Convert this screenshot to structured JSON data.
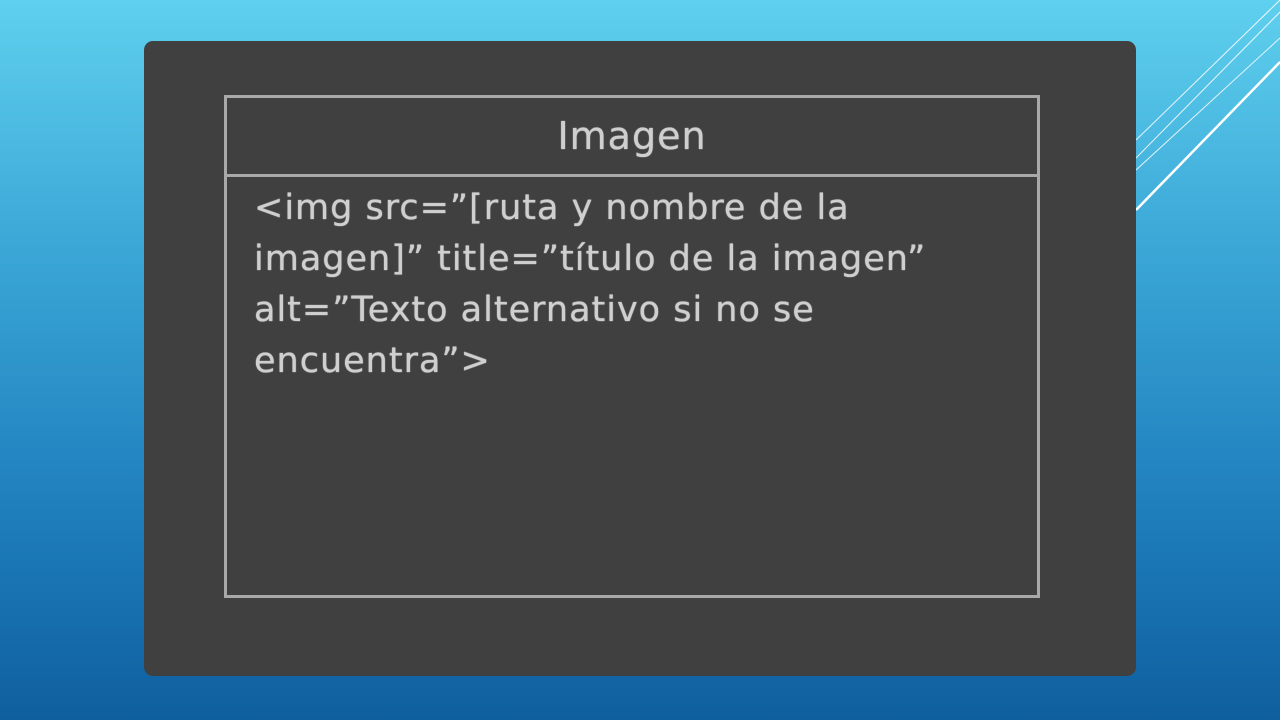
{
  "slide": {
    "background_colors": [
      "#5fd0ee",
      "#0f5f9e"
    ],
    "panel_color": "#404040",
    "accent_line_color": "#ffffff"
  },
  "table": {
    "header": "Imagen",
    "cell_text": "<img src=”[ruta y nombre de la imagen]” title=”título de la imagen” alt=”Texto alternativo si no se encuentra”>",
    "border_color": "#a9a9a9",
    "text_color": "#cfcfcf"
  }
}
